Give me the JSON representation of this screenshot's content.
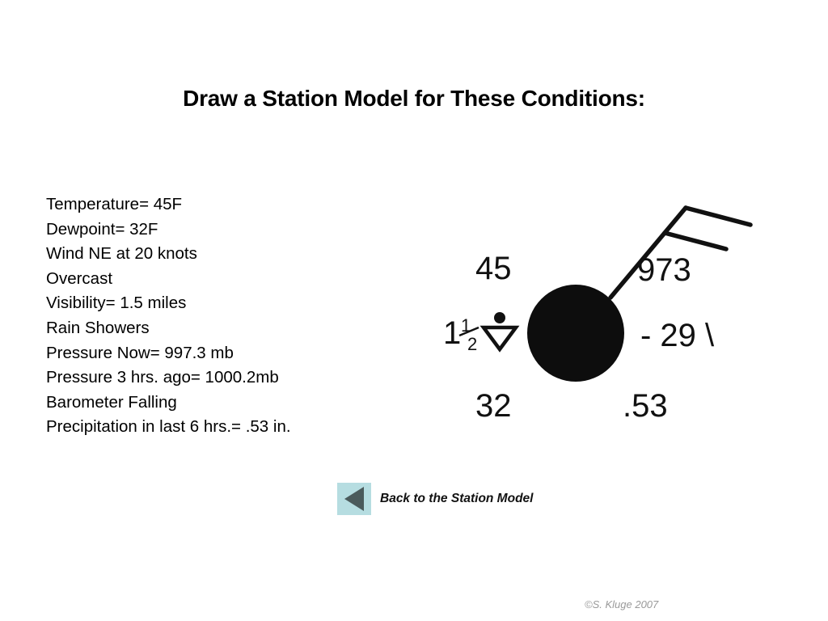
{
  "slide": {
    "title": "Draw a Station Model for These Conditions:",
    "background_color": "#ffffff",
    "text_color": "#000000"
  },
  "conditions": {
    "lines": [
      "Temperature= 45F",
      "Dewpoint= 32F",
      "Wind NE at 20 knots",
      "Overcast",
      "Visibility= 1.5 miles",
      "Rain Showers",
      "Pressure Now= 997.3 mb",
      "Pressure 3 hrs. ago= 1000.2mb",
      "Barometer Falling",
      "Precipitation in last 6 hrs.= .53 in."
    ]
  },
  "station_model": {
    "temperature": "45",
    "dewpoint": "32",
    "pressure": "973",
    "pressure_tendency": "- 29 \\",
    "precipitation": ".53",
    "visibility": "1",
    "visibility_fraction_numerator": "1",
    "visibility_fraction_denominator": "2",
    "sky_cover": "overcast",
    "present_weather": "rain-showers",
    "wind_direction": "NE",
    "wind_speed_knots": "20",
    "symbol_color": "#111111"
  },
  "navigation": {
    "back_label": "Back to the Station Model",
    "back_button_color": "#b6dde1",
    "back_arrow_color": "#4b5b5c"
  },
  "footer": {
    "credit": "©S. Kluge 2007",
    "credit_color": "#9a9a9a"
  }
}
